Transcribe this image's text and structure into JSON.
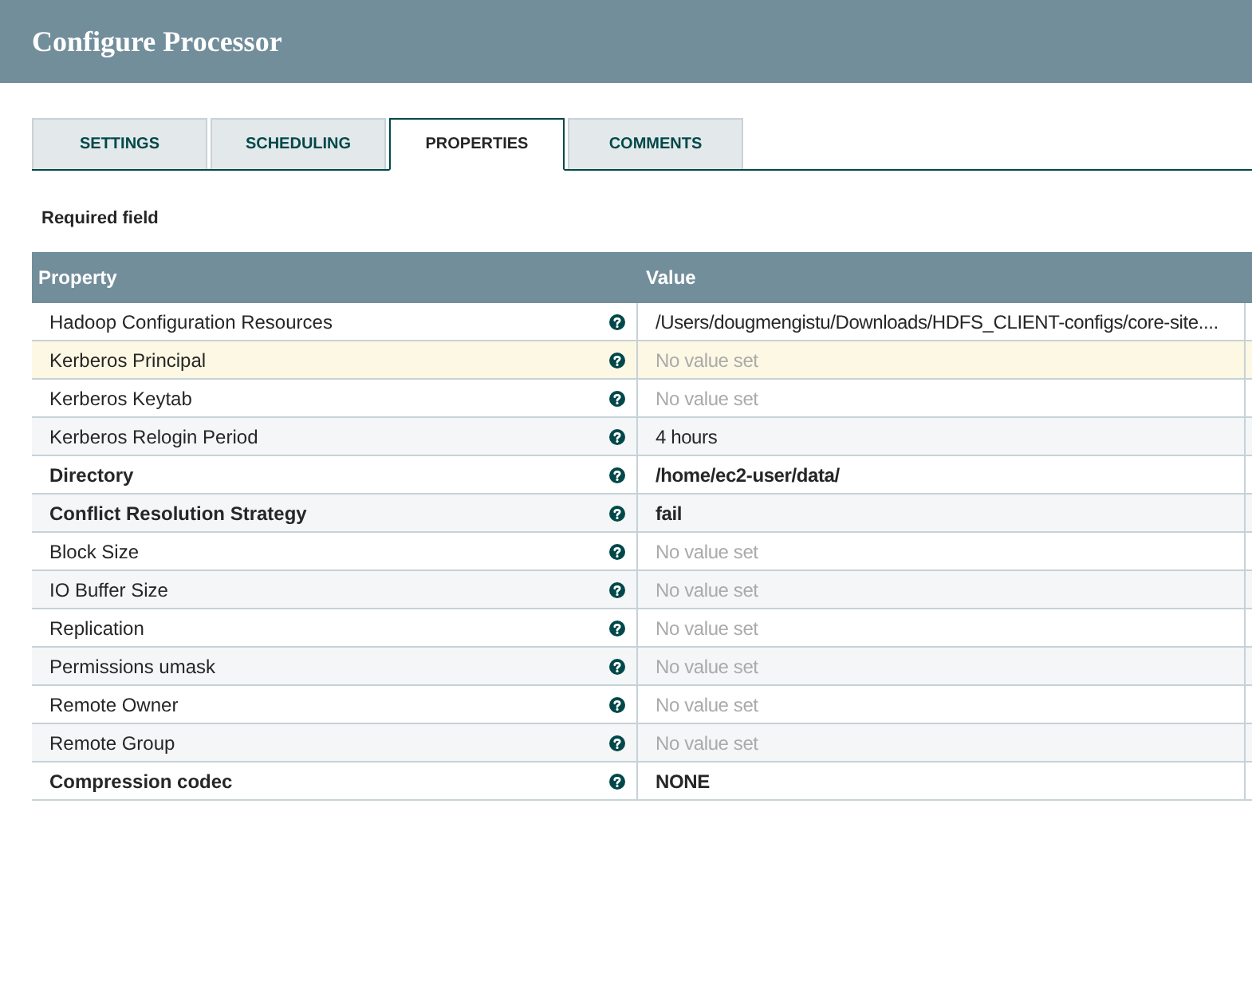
{
  "dialog": {
    "title": "Configure Processor"
  },
  "tabs": [
    {
      "label": "SETTINGS",
      "selected": false
    },
    {
      "label": "SCHEDULING",
      "selected": false
    },
    {
      "label": "PROPERTIES",
      "selected": true
    },
    {
      "label": "COMMENTS",
      "selected": false
    }
  ],
  "required_note": "Required field",
  "table": {
    "columns": [
      "Property",
      "Value"
    ],
    "rows": [
      {
        "property": "Hadoop Configuration Resources",
        "required": false,
        "value": "/Users/dougmengistu/Downloads/HDFS_CLIENT-configs/core-site....",
        "value_set": true,
        "selected": false
      },
      {
        "property": "Kerberos Principal",
        "required": false,
        "value": "No value set",
        "value_set": false,
        "selected": true
      },
      {
        "property": "Kerberos Keytab",
        "required": false,
        "value": "No value set",
        "value_set": false,
        "selected": false
      },
      {
        "property": "Kerberos Relogin Period",
        "required": false,
        "value": "4 hours",
        "value_set": true,
        "selected": false
      },
      {
        "property": "Directory",
        "required": true,
        "value": "/home/ec2-user/data/",
        "value_set": true,
        "selected": false
      },
      {
        "property": "Conflict Resolution Strategy",
        "required": true,
        "value": "fail",
        "value_set": true,
        "selected": false
      },
      {
        "property": "Block Size",
        "required": false,
        "value": "No value set",
        "value_set": false,
        "selected": false
      },
      {
        "property": "IO Buffer Size",
        "required": false,
        "value": "No value set",
        "value_set": false,
        "selected": false
      },
      {
        "property": "Replication",
        "required": false,
        "value": "No value set",
        "value_set": false,
        "selected": false
      },
      {
        "property": "Permissions umask",
        "required": false,
        "value": "No value set",
        "value_set": false,
        "selected": false
      },
      {
        "property": "Remote Owner",
        "required": false,
        "value": "No value set",
        "value_set": false,
        "selected": false
      },
      {
        "property": "Remote Group",
        "required": false,
        "value": "No value set",
        "value_set": false,
        "selected": false
      },
      {
        "property": "Compression codec",
        "required": true,
        "value": "NONE",
        "value_set": true,
        "selected": false
      }
    ]
  }
}
